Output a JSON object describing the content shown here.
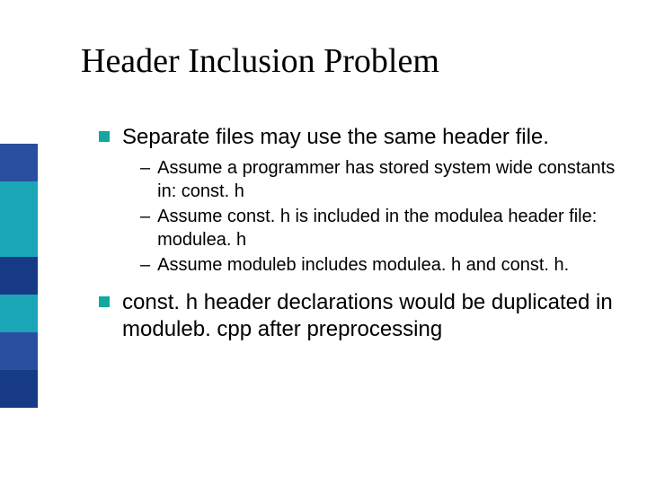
{
  "deco_colors": [
    "#2a4fa0",
    "#1aa6b7",
    "#1aa6b7",
    "#163a86",
    "#1aa6b7",
    "#2a4fa0",
    "#163a86"
  ],
  "bullet_color": "#12a89e",
  "title": "Header Inclusion Problem",
  "points": [
    {
      "text": "Separate files may use the same header file.",
      "sub": [
        "Assume a programmer has stored system wide constants in: const. h",
        "Assume const. h is included in the modulea header file: modulea. h",
        "Assume moduleb includes modulea. h and const. h."
      ]
    },
    {
      "text": "const. h header declarations would be duplicated in moduleb. cpp after preprocessing",
      "sub": []
    }
  ]
}
